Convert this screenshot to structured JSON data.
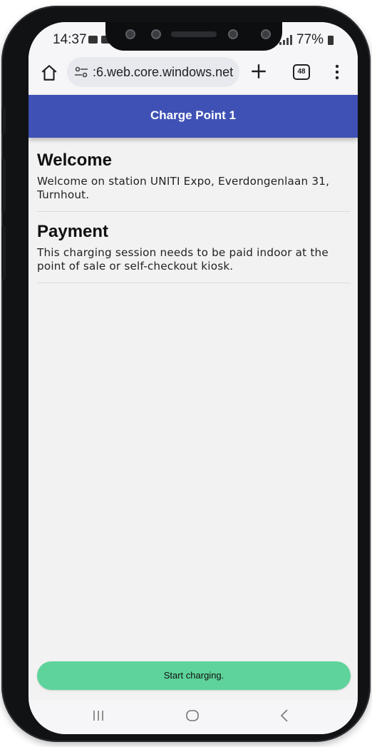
{
  "status_bar": {
    "time": "14:37",
    "battery": "77%"
  },
  "browser": {
    "url": ":6.web.core.windows.net",
    "tab_count": "48"
  },
  "header": {
    "title": "Charge Point 1"
  },
  "sections": [
    {
      "heading": "Welcome",
      "text": "Welcome on station UNITI Expo, Everdongenlaan 31, Turnhout."
    },
    {
      "heading": "Payment",
      "text": "This charging session needs to be paid indoor at the point of sale or self-checkout kiosk."
    }
  ],
  "actions": {
    "start_label": "Start charging."
  },
  "colors": {
    "header_bg": "#3f51b5",
    "button_bg": "#5ed39b",
    "page_bg": "#f2f2f2"
  },
  "icons": {
    "home": "home-icon",
    "site_settings": "tune-icon",
    "new_tab": "plus-icon",
    "tabs": "tab-switcher-icon",
    "menu": "more-vert-icon",
    "nav_recent": "recent-apps-icon",
    "nav_home": "nav-home-icon",
    "nav_back": "back-icon"
  }
}
